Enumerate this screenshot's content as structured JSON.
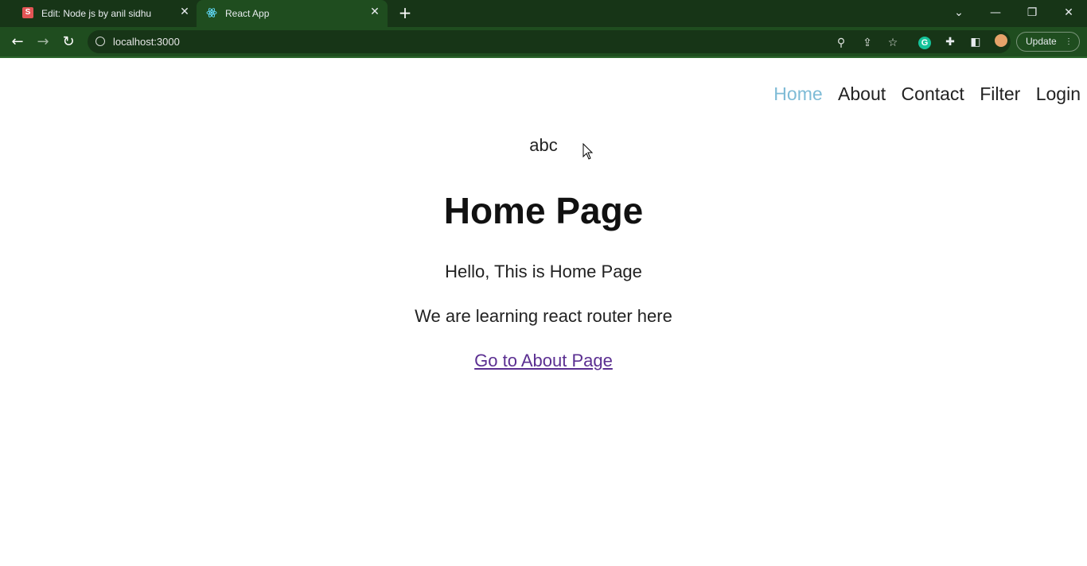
{
  "browser": {
    "tabs": [
      {
        "title": "Edit: Node js by anil sidhu",
        "favicon": "s-app-icon",
        "accent": "#e25555"
      },
      {
        "title": "React App",
        "favicon": "react-icon",
        "accent": "#61dafb"
      }
    ],
    "url": "localhost:3000",
    "update_label": "Update",
    "theme_color": "#1f4d1f"
  },
  "nav": {
    "items": [
      {
        "label": "Home",
        "active": true
      },
      {
        "label": "About",
        "active": false
      },
      {
        "label": "Contact",
        "active": false
      },
      {
        "label": "Filter",
        "active": false
      },
      {
        "label": "Login",
        "active": false
      }
    ],
    "active_color": "#7ebbd6"
  },
  "page": {
    "top_text": "abc",
    "heading": "Home Page",
    "paragraph1": "Hello, This is Home Page",
    "paragraph2": "We are learning react router here",
    "link_text": "Go to About Page",
    "link_color": "#5b2f91"
  }
}
